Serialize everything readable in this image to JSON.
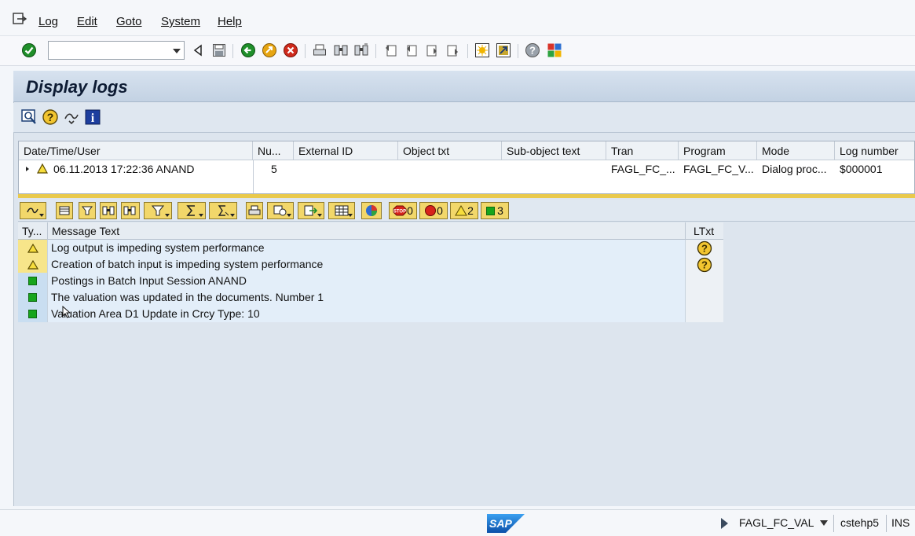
{
  "menu": {
    "items": [
      {
        "label": "Log"
      },
      {
        "label": "Edit"
      },
      {
        "label": "Goto"
      },
      {
        "label": "System"
      },
      {
        "label": "Help"
      }
    ]
  },
  "toolbar": {
    "command_field": {
      "value": "",
      "placeholder": ""
    },
    "icons": [
      "enter-icon",
      "back-triangle-icon",
      "save-icon",
      "back-icon",
      "exit-icon",
      "cancel-icon",
      "print-icon",
      "find-icon",
      "find-next-icon",
      "first-page-icon",
      "previous-page-icon",
      "next-page-icon",
      "last-page-icon",
      "new-session-icon",
      "shortcut-icon",
      "help-icon",
      "customize-layout-icon"
    ]
  },
  "title": "Display logs",
  "log_table": {
    "columns": [
      "Date/Time/User",
      "Nu...",
      "External ID",
      "Object txt",
      "Sub-object text",
      "Tran",
      "Program",
      "Mode",
      "Log number"
    ],
    "rows": [
      {
        "datetime_user": "06.11.2013  17:22:36  ANAND",
        "number": "5",
        "external_id": "",
        "object_txt": "",
        "subobject_text": "",
        "tran": "FAGL_FC_...",
        "program": "FAGL_FC_V...",
        "mode": "Dialog proc...",
        "log_number": "$000001"
      }
    ]
  },
  "alv_counters": {
    "stop": "0",
    "error": "0",
    "warning": "2",
    "success": "3"
  },
  "messages_table": {
    "columns": [
      "Ty...",
      "Message Text",
      "LTxt"
    ],
    "rows": [
      {
        "type": "warning",
        "text": "Log output is impeding system performance",
        "has_ltxt": true
      },
      {
        "type": "warning",
        "text": "Creation of batch input is impeding system performance",
        "has_ltxt": true
      },
      {
        "type": "success",
        "text": "Postings in Batch Input Session ANAND",
        "has_ltxt": false
      },
      {
        "type": "success",
        "text": "The valuation was updated in the documents. Number 1",
        "has_ltxt": false
      },
      {
        "type": "success",
        "text": "Valuation Area D1 Update in Crcy Type: 10",
        "has_ltxt": false
      }
    ]
  },
  "status_bar": {
    "transaction": "FAGL_FC_VAL",
    "server": "cstehp5",
    "mode": "INS"
  },
  "colors": {
    "warning": "#f7e58a",
    "success": "#17a51c",
    "title_bar": "#c3d2e3",
    "splitter": "#e9c94c"
  }
}
